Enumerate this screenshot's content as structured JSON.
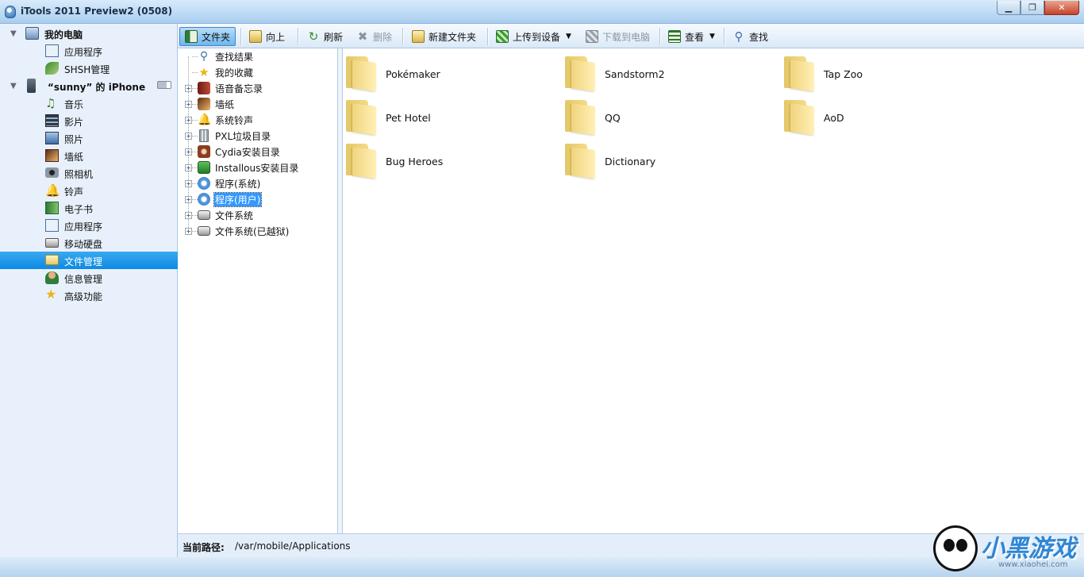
{
  "window": {
    "title": "iTools 2011 Preview2 (0508)",
    "min": "▁",
    "max": "❐",
    "close": "✕"
  },
  "sidebar": {
    "groups": [
      {
        "label": "我的电脑",
        "items": [
          "应用程序",
          "SHSH管理"
        ]
      },
      {
        "label": "“sunny” 的 iPhone",
        "items": [
          "音乐",
          "影片",
          "照片",
          "墙纸",
          "照相机",
          "铃声",
          "电子书",
          "应用程序",
          "移动硬盘",
          "文件管理",
          "信息管理",
          "高级功能"
        ]
      }
    ],
    "selected": "文件管理"
  },
  "toolbar": {
    "folder": "文件夹",
    "up": "向上",
    "refresh": "刷新",
    "delete": "删除",
    "new_folder": "新建文件夹",
    "upload": "上传到设备",
    "download": "下载到电脑",
    "view": "查看",
    "find": "查找",
    "caret": "▼"
  },
  "tree": {
    "items": [
      "查找结果",
      "我的收藏",
      "语音备忘录",
      "墙纸",
      "系统铃声",
      "PXL垃圾目录",
      "Cydia安装目录",
      "Installous安装目录",
      "程序(系统)",
      "程序(用户)",
      "文件系统",
      "文件系统(已越狱)"
    ],
    "selected": "程序(用户)",
    "expander": "+"
  },
  "folders": [
    "Pokémaker",
    "Sandstorm2",
    "Tap Zoo",
    "Pet Hotel",
    "QQ",
    "AoD",
    "Bug Heroes",
    "Dictionary"
  ],
  "status": {
    "path_label": "当前路径:",
    "path_value": "/var/mobile/Applications"
  },
  "watermark": {
    "brand": "小黑游戏",
    "domain": "www.xiaohei.com"
  },
  "colors": {
    "accent": "#0d8ae3",
    "selection": "#3399ff",
    "folder": "#f0d57e"
  },
  "icons": {
    "sidebar": [
      "computer-icon",
      "app-icon",
      "shsh-icon",
      "iphone-icon",
      "music-icon",
      "video-icon",
      "photo-icon",
      "wallpaper-icon",
      "camera-icon",
      "ringtone-icon",
      "ebook-icon",
      "app-icon",
      "disk-icon",
      "folder-icon",
      "contacts-icon",
      "star-icon"
    ]
  }
}
